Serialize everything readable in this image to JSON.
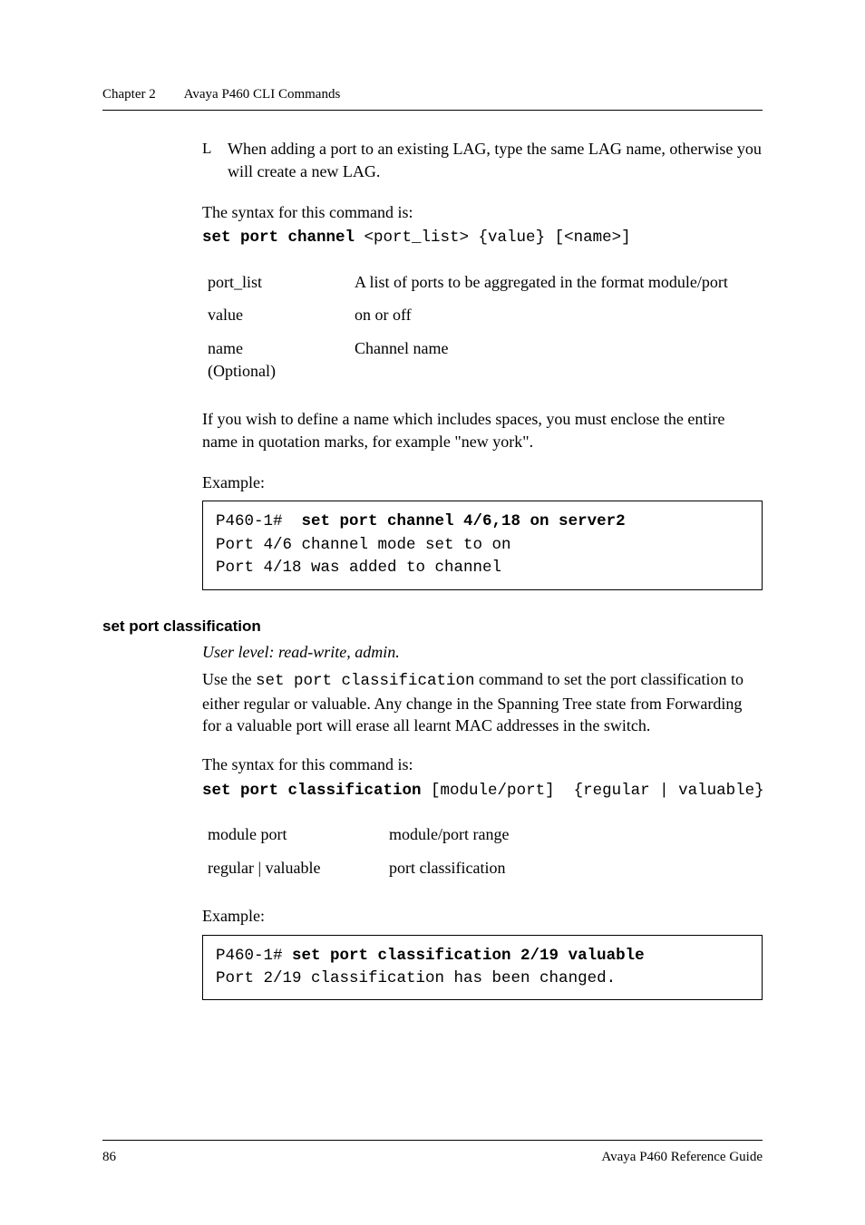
{
  "runhead": {
    "chapter": "Chapter 2",
    "title": "Avaya P460 CLI Commands"
  },
  "bullet": {
    "mark": "L",
    "text": "When adding a port to an existing LAG, type the same LAG name, otherwise you will create a new LAG."
  },
  "syntax_intro": "The syntax for this command is:",
  "cmd1_bold": "set port channel",
  "cmd1_rest": " <port_list> {value} [<name>]",
  "params1": {
    "port_list_k": "port_list",
    "port_list_v": "A list of ports to be aggregated in the format module/port",
    "value_k": "value",
    "value_v": "on or off",
    "name_k1": "name",
    "name_k2": "(Optional)",
    "name_v": "Channel name"
  },
  "note1": "If you wish to define a name which includes spaces, you must enclose the entire name in quotation marks, for example \"new york\".",
  "example_label": "Example:",
  "codebox1_line1a": "P460-1#  ",
  "codebox1_line1b": "set port channel 4/6,18 on server2",
  "codebox1_line2": "Port 4/6 channel mode set to on",
  "codebox1_line3": "Port 4/18 was added to channel",
  "section2": "set port classification",
  "userlevel": "User level: read-write, admin.",
  "desc2a": "Use the ",
  "desc2b": "set port classification",
  "desc2c": " command to set the port classification to either regular or valuable. Any change in the Spanning Tree state from Forwarding for a valuable port will erase all learnt MAC addresses in the switch.",
  "cmd2_bold": "set port classification",
  "cmd2_rest": " [module/port]  {regular | valuable}",
  "params2": {
    "mp_k": "module port",
    "mp_v": "module/port range",
    "rv_k": "regular | valuable",
    "rv_v": "port classification"
  },
  "codebox2_line1a": "P460-1# ",
  "codebox2_line1b": "set port classification 2/19 valuable",
  "codebox2_line2": "Port 2/19 classification has been changed.",
  "footer": {
    "page": "86",
    "doc": "Avaya P460 Reference Guide"
  }
}
